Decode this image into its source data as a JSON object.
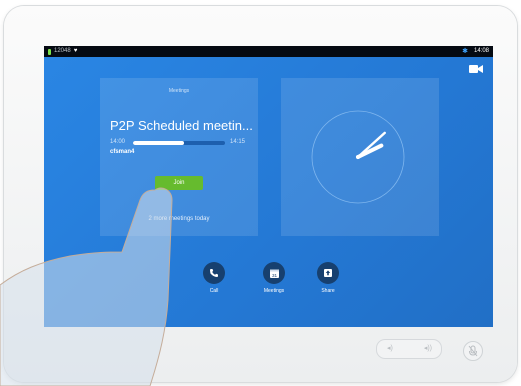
{
  "status_bar": {
    "extension": "12048",
    "time": "14:08"
  },
  "meetings_card": {
    "title": "Meetings",
    "meeting_name": "P2P Scheduled meetin...",
    "start_time": "14:00",
    "end_time": "14:15",
    "progress_percent": 55,
    "organizer": "cfsman4",
    "join_label": "Join",
    "more_meetings": "2 more meetings today"
  },
  "clock": {
    "hour": 2,
    "minute": 8
  },
  "actions": [
    {
      "label": "Call",
      "icon": "phone-icon"
    },
    {
      "label": "Meetings",
      "icon": "calendar-icon",
      "icon_text": "31"
    },
    {
      "label": "Share",
      "icon": "share-icon"
    }
  ],
  "colors": {
    "screen_bg": "#2a86e4",
    "join_green": "#66bb2e",
    "action_circle": "#17406f",
    "status_bar": "#050a12"
  }
}
